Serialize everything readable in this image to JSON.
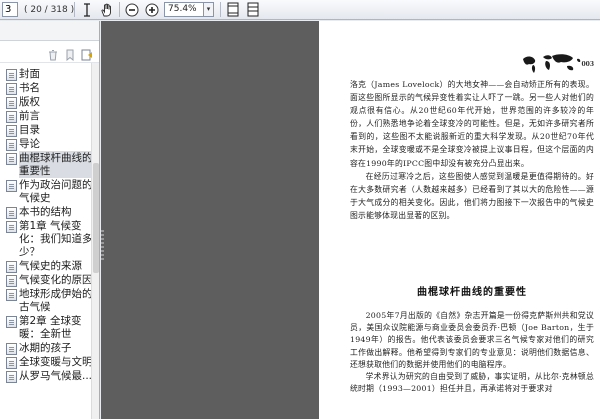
{
  "toolbar": {
    "page_current": "3",
    "page_total": "( 20 / 318 )",
    "zoom_value": "75.4%",
    "zoom_drop": "▾"
  },
  "sidebar": {
    "items": [
      {
        "label": "封面"
      },
      {
        "label": "书名"
      },
      {
        "label": "版权"
      },
      {
        "label": "前言"
      },
      {
        "label": "目录"
      },
      {
        "label": "导论"
      },
      {
        "label": "曲棍球杆曲线的重要性"
      },
      {
        "label": "作为政治问题的气候史"
      },
      {
        "label": "本书的结构"
      },
      {
        "label": "第1章 气候变化：我们知道多少？"
      },
      {
        "label": "气候史的来源"
      },
      {
        "label": "气候变化的原因"
      },
      {
        "label": "地球形成伊始的古气候"
      },
      {
        "label": "第2章 全球变暖：全新世"
      },
      {
        "label": "冰期的孩子"
      },
      {
        "label": "全球变暖与文明"
      },
      {
        "label": "从罗马气候最..."
      }
    ],
    "selected_index": 6
  },
  "document": {
    "page_number": "003",
    "paragraphs_top": [
      "洛克（James Lovelock）的大地女神——会自动矫正所有的表现。面这些图所显示的气候异变性着实让人吓了一跳。另一些人对他们的观点很有信心。从20世纪60年代开始，世界范围的许多较冷的年份，人们熟悉地争论着全球变冷的可能性。但是，无如许多研究者所看到的，这些图不太能说服新近的重大科学发现。从20世纪70年代末开始，全球变暖或不是全球变冷被提上议事日程，但这个层面的内容在1990年的IPCC图中却没有被充分凸显出来。",
      "在经历过寒冷之后，这些图使人感觉到温暖是更值得期待的。好在大多数研究者（人数越来越多）已经看到了其以大的危险性——源于大气成分的相关变化。因此，他们将力图接下一次报告中的气候史图示能够体现出显著的区别。"
    ],
    "heading": "曲棍球杆曲线的重要性",
    "paragraphs_bottom": [
      "2005年7月出版的《自然》杂志开篇是一份得克萨斯州共和党议员，美国众议院能源与商业委员会委员乔·巴顿（Joe Barton，生于1949年）的报告。他代表该委员会要求三名气候专家对他们的研究工作做出解释。他希望得到专家们的专业意见：说明他们数据信息、还想获取他们的数据并使用他们的电脑程序。",
      "学术界认为研究的自由受到了威胁，事实证明，从比尔·克林顿总统时期（1993—2001）担任并且，再承诺将对于要求对"
    ]
  },
  "colors": {
    "doc_background": "#5e5e5e",
    "page": "#ffffff",
    "toolbar": "#e9ecf1"
  }
}
